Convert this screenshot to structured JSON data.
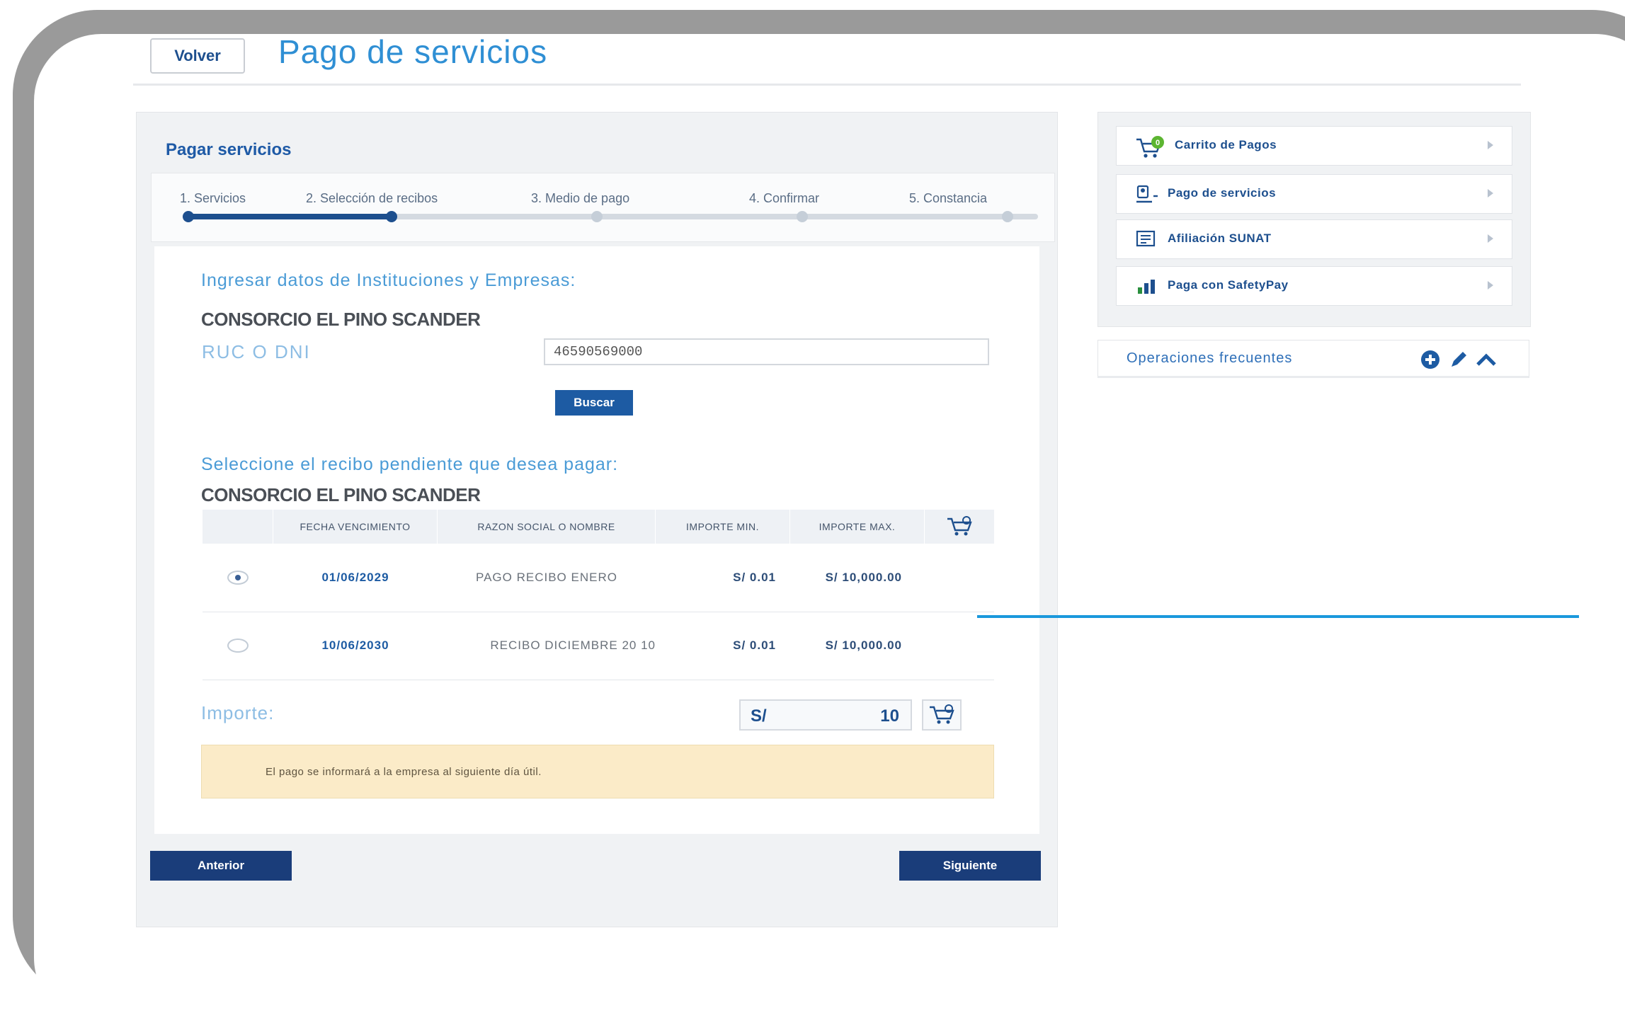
{
  "header": {
    "back_label": "Volver",
    "title": "Pago de servicios"
  },
  "main": {
    "heading": "Pagar servicios",
    "steps": [
      {
        "label": "1. Servicios",
        "state": "done"
      },
      {
        "label": "2. Selección de recibos",
        "state": "current"
      },
      {
        "label": "3. Medio de pago",
        "state": "pending"
      },
      {
        "label": "4. Confirmar",
        "state": "pending"
      },
      {
        "label": "5. Constancia",
        "state": "pending"
      }
    ],
    "form_heading": "Ingresar datos de Instituciones y Empresas:",
    "company": "CONSORCIO EL PINO SCANDER",
    "ruc_label": "RUC O DNI",
    "ruc_value": "46590569000",
    "search_label": "Buscar",
    "select_heading": "Seleccione el recibo pendiente que desea pagar:",
    "table": {
      "columns": [
        "",
        "FECHA VENCIMIENTO",
        "RAZON SOCIAL O NOMBRE",
        "IMPORTE MIN.",
        "IMPORTE MAX.",
        "cart-icon"
      ],
      "rows": [
        {
          "selected": true,
          "date": "01/06/2029",
          "description": "PAGO RECIBO ENERO",
          "min": "S/ 0.01",
          "max": "S/ 10,000.00"
        },
        {
          "selected": false,
          "date": "10/06/2030",
          "description": "RECIBO DICIEMBRE 20 10",
          "min": "S/ 0.01",
          "max": "S/ 10,000.00"
        }
      ]
    },
    "amount_label": "Importe:",
    "currency": "S/",
    "amount_value": "10",
    "notice": "El pago se informará a la empresa al siguiente día útil.",
    "prev_label": "Anterior",
    "next_label": "Siguiente"
  },
  "side": {
    "items": [
      {
        "label": "Carrito de Pagos",
        "icon": "cart-icon",
        "badge": "0"
      },
      {
        "label": "Pago de servicios",
        "icon": "service-payment-icon"
      },
      {
        "label": "Afiliación SUNAT",
        "icon": "sunat-icon"
      },
      {
        "label": "Paga con SafetyPay",
        "icon": "safetypay-icon"
      }
    ],
    "ops_label": "Operaciones frecuentes"
  },
  "colors": {
    "primary": "#1d4f8e",
    "accent": "#2f8fd4",
    "notice_bg": "#fbebc8",
    "callout_line": "#1a98dc"
  }
}
